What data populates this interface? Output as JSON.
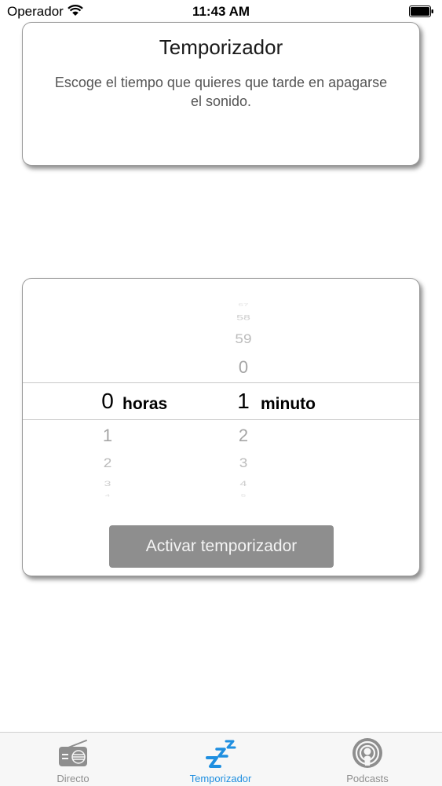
{
  "status_bar": {
    "carrier": "Operador",
    "time": "11:43 AM",
    "wifi_icon": "wifi-icon",
    "battery_icon": "battery-icon"
  },
  "info_card": {
    "title": "Temporizador",
    "description": "Escoge el tiempo que quieres que tarde en apagarse el sonido."
  },
  "picker": {
    "hours": {
      "selected": "0",
      "unit": "horas",
      "next": [
        "1",
        "2",
        "3",
        "4"
      ]
    },
    "minutes": {
      "selected": "1",
      "unit": "minuto",
      "previous": [
        "0",
        "59",
        "58",
        "57"
      ],
      "next": [
        "2",
        "3",
        "4",
        "5"
      ]
    }
  },
  "activate_button": {
    "label": "Activar temporizador"
  },
  "tab_bar": {
    "active_color": "#1f8fe0",
    "inactive_color": "#8e8e8e",
    "tabs": [
      {
        "label": "Directo",
        "icon": "radio-icon"
      },
      {
        "label": "Temporizador",
        "icon": "sleep-zzz-icon"
      },
      {
        "label": "Podcasts",
        "icon": "podcast-icon"
      }
    ]
  }
}
